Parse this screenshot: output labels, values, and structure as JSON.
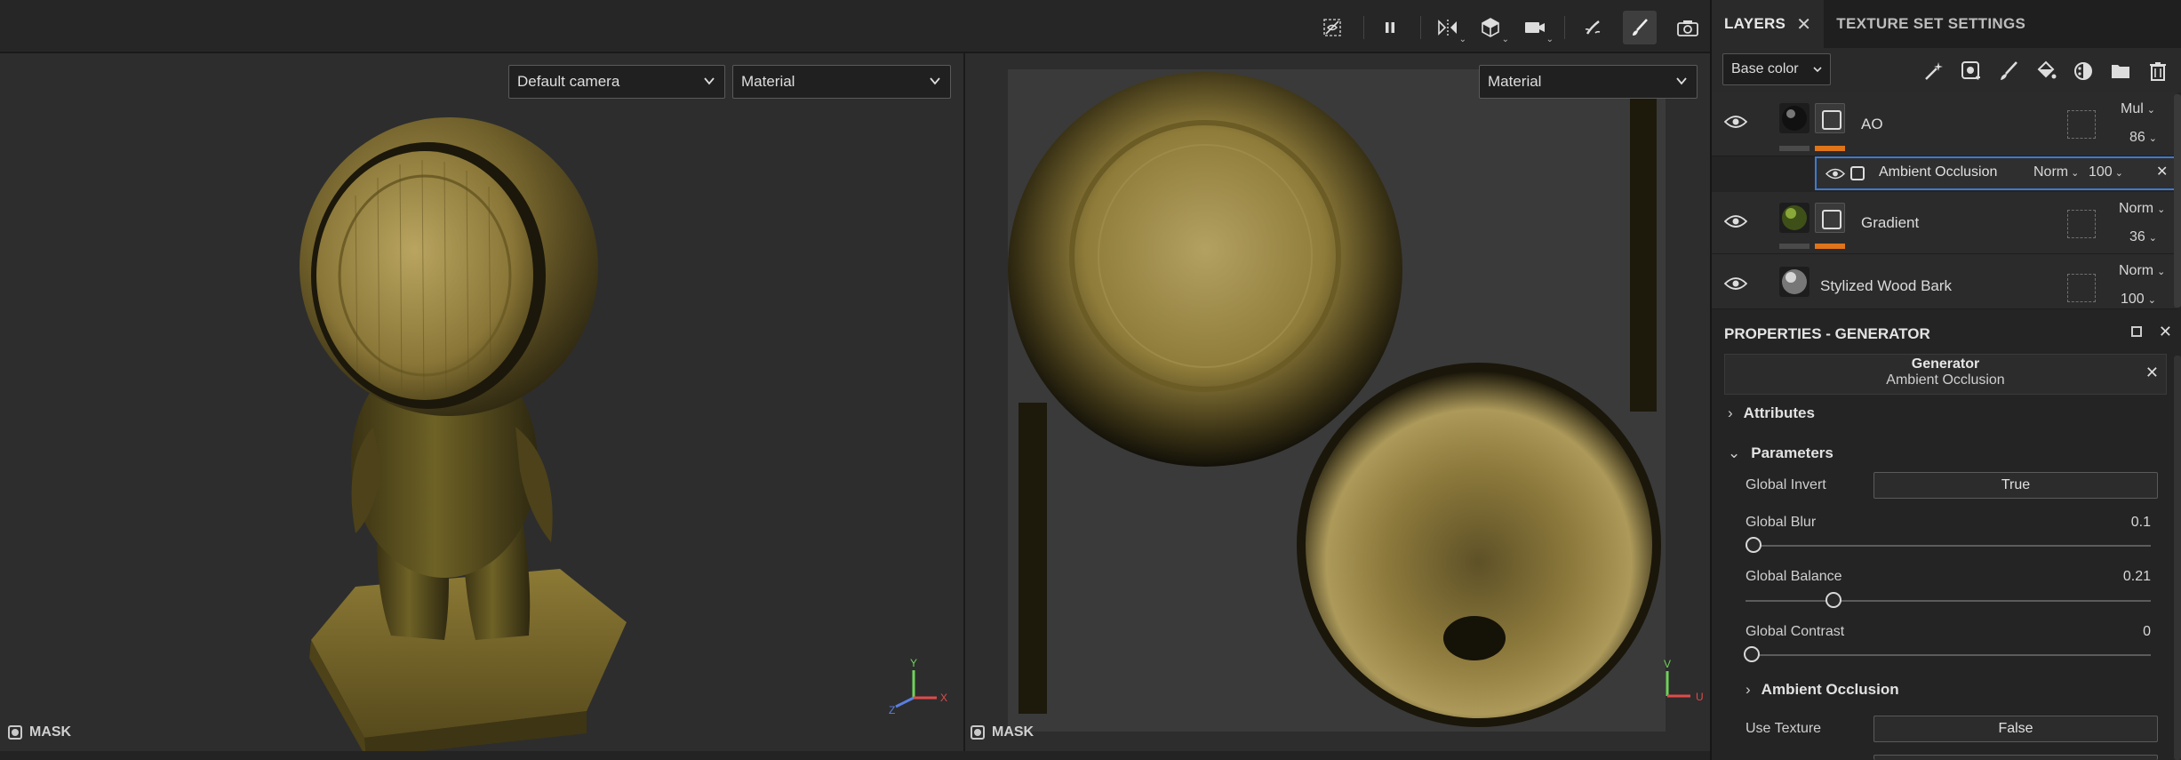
{
  "toolbar": {
    "buttons": [
      {
        "icon": "hide-overlay-icon"
      },
      {
        "icon": "pause-icon"
      },
      {
        "icon": "symmetry-icon"
      },
      {
        "icon": "display-mode-cube-icon"
      },
      {
        "icon": "camera-icon"
      },
      {
        "icon": "paint-brush-pose-icon"
      },
      {
        "icon": "paint-brush-icon",
        "active": true
      },
      {
        "icon": "screenshot-camera-icon"
      }
    ]
  },
  "viewport3d": {
    "camera_dropdown": "Default camera",
    "material_dropdown": "Material",
    "mask_label": "MASK",
    "axes": {
      "y": "Y",
      "x": "X",
      "z": "Z"
    }
  },
  "viewport2d": {
    "material_dropdown": "Material",
    "mask_label": "MASK",
    "axes": {
      "v": "V",
      "u": "U"
    }
  },
  "right_panel": {
    "tabs": [
      {
        "label": "LAYERS",
        "active": true,
        "closable": true
      },
      {
        "label": "TEXTURE SET SETTINGS",
        "active": false
      }
    ],
    "channel_select": "Base color",
    "layer_tools": [
      "add-effect-icon",
      "add-mask-icon",
      "add-paint-layer-icon",
      "add-fill-layer-icon",
      "add-layer-instance-icon",
      "add-folder-icon",
      "delete-icon"
    ],
    "layers": [
      {
        "name": "AO",
        "blend": "Mul",
        "opacity": "86"
      },
      {
        "name": "Gradient",
        "blend": "Norm",
        "opacity": "36"
      },
      {
        "name": "Stylized Wood Bark",
        "blend": "Norm",
        "opacity": "100"
      }
    ],
    "sub_effect": {
      "name": "Ambient Occlusion",
      "blend": "Norm",
      "opacity": "100"
    },
    "properties": {
      "title": "PROPERTIES - GENERATOR",
      "generator_type": "Generator",
      "generator_name": "Ambient Occlusion",
      "sections": {
        "attributes": "Attributes",
        "parameters": "Parameters",
        "ambient_occlusion": "Ambient Occlusion"
      },
      "params": {
        "global_invert_label": "Global Invert",
        "global_invert_value": "True",
        "global_blur_label": "Global Blur",
        "global_blur_value": "0.1",
        "global_balance_label": "Global Balance",
        "global_balance_value": "0.21",
        "global_contrast_label": "Global Contrast",
        "global_contrast_value": "0",
        "use_texture_label": "Use Texture",
        "use_texture_value": "False"
      }
    }
  },
  "colors": {
    "accent_orange": "#e0741a",
    "selection_blue": "#3d7ad0",
    "axis_x": "#e04a4a",
    "axis_y": "#6fd35a",
    "axis_z": "#5a7fe0"
  }
}
